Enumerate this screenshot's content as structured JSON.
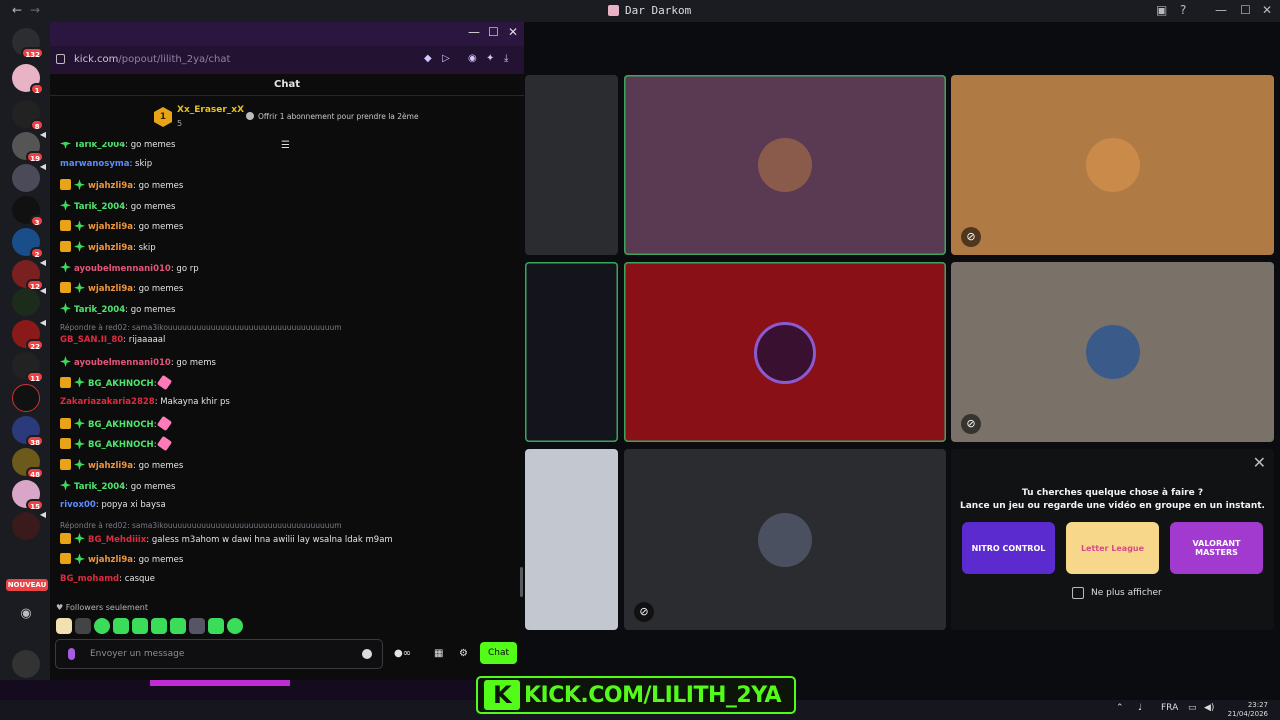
{
  "discord": {
    "window_title": "Dar Darkom",
    "server_badges": [
      "132",
      "1",
      "8",
      "19",
      "3",
      "2",
      "12",
      "22",
      "11",
      "38",
      "48",
      "15"
    ],
    "new_label": "NOUVEAU"
  },
  "kick_chat": {
    "url_host": "kick.com",
    "url_path": "/popout/lilith_2ya/chat",
    "header": "Chat",
    "pinned": {
      "rank": "1",
      "username": "Xx_Eraser_xX",
      "count": "5",
      "offer": "Offrir 1 abonnement pour prendre la 2ème"
    },
    "messages": [
      {
        "user": "Tarik_2004",
        "text": "go memes",
        "color": "#4fe66f"
      },
      {
        "user": "marwanosyma",
        "text": "skip",
        "color": "#5b8cff"
      },
      {
        "user": "wjahzli9a",
        "text": "go memes",
        "color": "#f1963b"
      },
      {
        "user": "Tarik_2004",
        "text": "go memes",
        "color": "#4fe66f"
      },
      {
        "user": "wjahzli9a",
        "text": "go memes",
        "color": "#f1963b"
      },
      {
        "user": "wjahzli9a",
        "text": "skip",
        "color": "#f1963b"
      },
      {
        "user": "ayoubelmennani010",
        "text": "go rp",
        "color": "#e2557a"
      },
      {
        "user": "wjahzli9a",
        "text": "go memes",
        "color": "#f1963b"
      },
      {
        "user": "Tarik_2004",
        "text": "go memes",
        "color": "#4fe66f"
      },
      {
        "user": "GB_SAN.II_80",
        "text": "rijaaaaal",
        "color": "#e02a3e",
        "reply": "Répondre à red02: sama3ikouuuuuuuuuuuuuuuuuuuuuuuuuuuuuuuuuuum"
      },
      {
        "user": "ayoubelmennani010",
        "text": "go mems",
        "color": "#e2557a"
      },
      {
        "user": "BG_AKHNOCH",
        "text": "",
        "color": "#4fe66f"
      },
      {
        "user": "Zakariazakaria2828",
        "text": "Makayna khir ps",
        "color": "#e02a3e"
      },
      {
        "user": "BG_AKHNOCH",
        "text": "",
        "color": "#4fe66f"
      },
      {
        "user": "BG_AKHNOCH",
        "text": "",
        "color": "#4fe66f"
      },
      {
        "user": "wjahzli9a",
        "text": "go memes",
        "color": "#f1963b"
      },
      {
        "user": "Tarik_2004",
        "text": "go memes",
        "color": "#4fe66f"
      },
      {
        "user": "rivox00",
        "text": "popya xi baysa",
        "color": "#5b8cff"
      },
      {
        "user": "BG_Mehdiiix",
        "text": "galess m3ahom w dawi hna awilii lay wsalna ldak m9am",
        "color": "#e02a3e",
        "reply": "Répondre à red02: sama3ikouuuuuuuuuuuuuuuuuuuuuuuuuuuuuuuuuuum"
      },
      {
        "user": "wjahzli9a",
        "text": "go memes",
        "color": "#f1963b"
      },
      {
        "user": "BG_mohamd",
        "text": "casque",
        "color": "#e02a3e"
      }
    ],
    "followers_only": "Followers seulement",
    "input_placeholder": "Envoyer un message",
    "send_label": "Chat"
  },
  "activity": {
    "line1": "Tu cherches quelque chose à faire ?",
    "line2": "Lance un jeu ou regarde une vidéo en groupe en un instant.",
    "games": [
      "NITRO CONTROL",
      "Letter League",
      "VALORANT MASTERS"
    ],
    "dont_show": "Ne plus afficher"
  },
  "overlay_banner": "KICK.COM/LILITH_2YA",
  "taskbar": {
    "lang": "FRA",
    "time": "23:27",
    "date": "21/04/2026"
  },
  "colors": {
    "kick_green": "#53fc18",
    "speaking_border": "#3ba55c",
    "discord_red": "#ed4245"
  }
}
